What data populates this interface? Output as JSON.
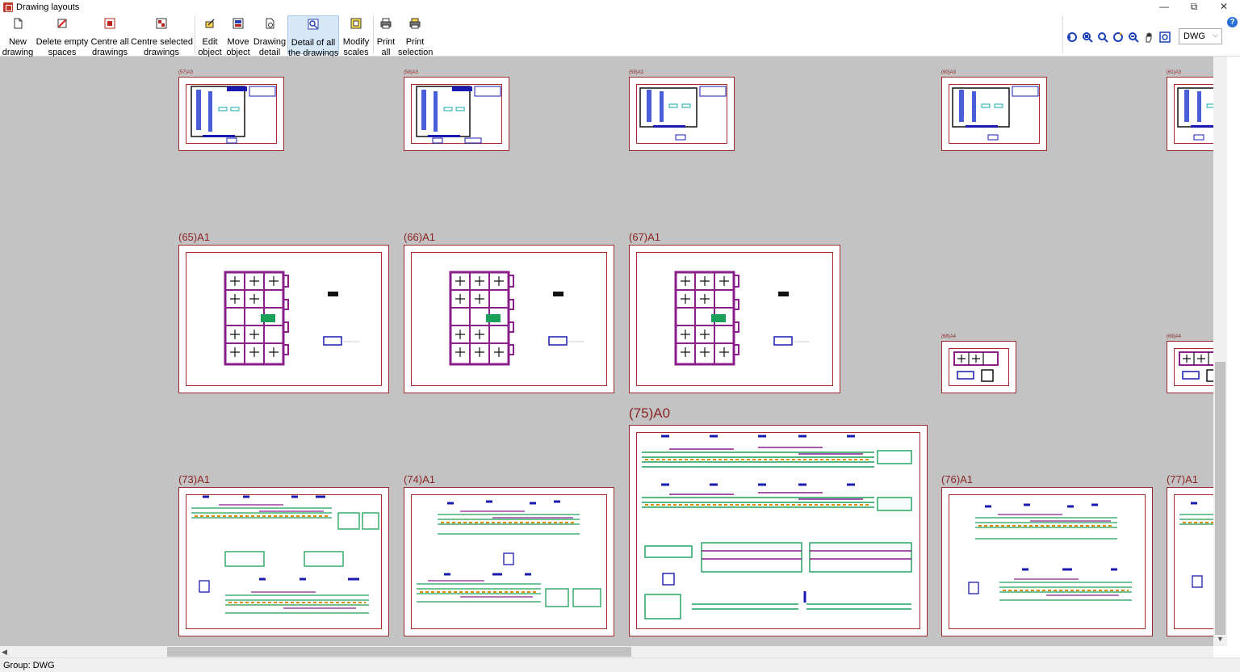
{
  "window": {
    "title": "Drawing layouts",
    "controls": {
      "minimize": "—",
      "restore": "⧉",
      "close": "✕"
    }
  },
  "toolbar": {
    "buttons": [
      {
        "id": "new-drawing",
        "label": "New\ndrawing",
        "icon": "new-page-icon"
      },
      {
        "id": "delete-empty-spaces",
        "label": "Delete empty\nspaces",
        "icon": "delete-spaces-icon"
      },
      {
        "id": "centre-all-drawings",
        "label": "Centre all\ndrawings",
        "icon": "centre-all-icon"
      },
      {
        "id": "centre-selected-drawings",
        "label": "Centre selected\ndrawings",
        "icon": "centre-selected-icon"
      },
      {
        "id": "edit-object",
        "label": "Edit\nobject",
        "icon": "edit-object-icon"
      },
      {
        "id": "move-object",
        "label": "Move\nobject",
        "icon": "move-object-icon"
      },
      {
        "id": "drawing-detail",
        "label": "Drawing\ndetail",
        "icon": "drawing-detail-icon"
      },
      {
        "id": "detail-of-all-drawings",
        "label": "Detail of all\nthe drawings",
        "icon": "detail-all-icon",
        "active": true
      },
      {
        "id": "modify-scales",
        "label": "Modify\nscales",
        "icon": "modify-scales-icon"
      },
      {
        "id": "print-all",
        "label": "Print\nall",
        "icon": "print-all-icon"
      },
      {
        "id": "print-selection",
        "label": "Print\nselection",
        "icon": "print-selection-icon"
      }
    ],
    "view_icons": [
      "zoom-previous-icon",
      "zoom-window-icon",
      "zoom-icon",
      "refresh-icon",
      "zoom-out-icon",
      "pan-hand-icon",
      "zoom-extents-icon"
    ],
    "group_select": {
      "value": "DWG"
    },
    "help": "?"
  },
  "sheets": {
    "s57": {
      "label": "(57)A3"
    },
    "s58": {
      "label": "(58)A3"
    },
    "s59": {
      "label": "(59)A3"
    },
    "s60": {
      "label": "(60)A3"
    },
    "s61": {
      "label": "(61)A3"
    },
    "s65": {
      "label": "(65)A1"
    },
    "s66": {
      "label": "(66)A1"
    },
    "s67": {
      "label": "(67)A1"
    },
    "s68": {
      "label": "(68)A4"
    },
    "s69": {
      "label": "(69)A4"
    },
    "s73": {
      "label": "(73)A1"
    },
    "s74": {
      "label": "(74)A1"
    },
    "s75": {
      "label": "(75)A0"
    },
    "s76": {
      "label": "(76)A1"
    },
    "s77": {
      "label": "(77)A1"
    }
  },
  "status": {
    "text": "Group: DWG"
  },
  "colors": {
    "canvas": "#c3c3c3",
    "sheet_border": "#9b2b2b",
    "label": "#8b2424",
    "green": "#1aa05a",
    "blue": "#1a1ab0",
    "purple": "#8a1f8a",
    "orange": "#e08a00"
  }
}
